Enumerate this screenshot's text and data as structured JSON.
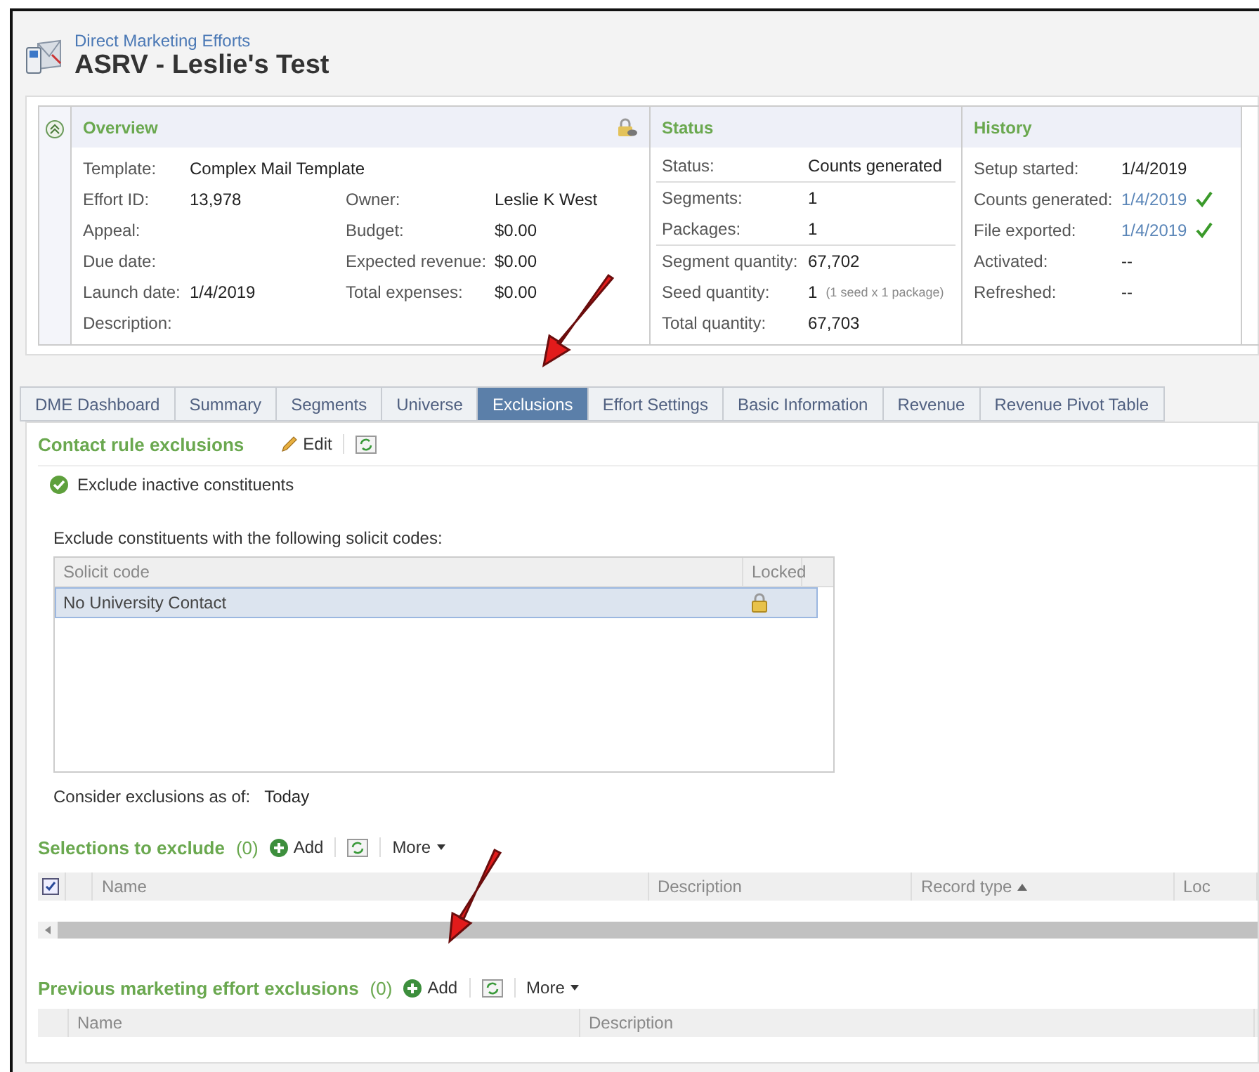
{
  "header": {
    "breadcrumb": "Direct Marketing Efforts",
    "title": "ASRV - Leslie's Test"
  },
  "overview": {
    "title": "Overview",
    "expanded": true,
    "left_fields": [
      {
        "label": "Template:",
        "value": "Complex Mail Template"
      },
      {
        "label": "Effort ID:",
        "value": "13,978"
      },
      {
        "label": "Appeal:"
      },
      {
        "label": "Due date:"
      },
      {
        "label": "Launch date:",
        "value": "1/4/2019"
      },
      {
        "label": "Description:"
      }
    ],
    "right_fields": [
      {
        "label": "Owner:",
        "value": "Leslie K West"
      },
      {
        "label": "Budget:",
        "value": "$0.00"
      },
      {
        "label": "Expected revenue:",
        "value": "$0.00"
      },
      {
        "label": "Total expenses:",
        "value": "$0.00"
      }
    ]
  },
  "status": {
    "title": "Status",
    "groups": [
      [
        {
          "label": "Status:",
          "value": "Counts generated"
        }
      ],
      [
        {
          "label": "Segments:",
          "value": "1"
        },
        {
          "label": "Packages:",
          "value": "1"
        }
      ],
      [
        {
          "label": "Segment quantity:",
          "value": "67,702"
        },
        {
          "label": "Seed quantity:",
          "value": "1",
          "note": "(1 seed x 1 package)"
        },
        {
          "label": "Total quantity:",
          "value": "67,703"
        }
      ]
    ]
  },
  "history": {
    "title": "History",
    "fields": [
      {
        "label": "Setup started:",
        "value": "1/4/2019",
        "done": false
      },
      {
        "label": "Counts generated:",
        "value": "1/4/2019",
        "done": true
      },
      {
        "label": "File exported:",
        "value": "1/4/2019",
        "done": true
      },
      {
        "label": "Activated:",
        "value": "--",
        "done": false
      },
      {
        "label": "Refreshed:",
        "value": "--",
        "done": false
      }
    ]
  },
  "tabs": [
    {
      "label": "DME Dashboard",
      "selected": false
    },
    {
      "label": "Summary",
      "selected": false
    },
    {
      "label": "Segments",
      "selected": false
    },
    {
      "label": "Universe",
      "selected": false
    },
    {
      "label": "Exclusions",
      "selected": true
    },
    {
      "label": "Effort Settings",
      "selected": false
    },
    {
      "label": "Basic Information",
      "selected": false
    },
    {
      "label": "Revenue",
      "selected": false
    },
    {
      "label": "Revenue Pivot Table",
      "selected": false
    }
  ],
  "contact_rules": {
    "title": "Contact rule exclusions",
    "edit": "Edit",
    "exclude_inactive": {
      "label": "Exclude inactive constituents",
      "checked": true
    },
    "intro": "Exclude constituents with the following solicit codes:",
    "columns": [
      "Solicit code",
      "Locked"
    ],
    "rows": [
      {
        "code": "No University Contact",
        "locked": true,
        "selected": true
      }
    ],
    "consider_label": "Consider exclusions as of:",
    "consider_value": "Today"
  },
  "selections": {
    "title": "Selections to exclude",
    "count": "(0)",
    "add": "Add",
    "more": "More",
    "all_checked": true,
    "columns": [
      "Name",
      "Description",
      "Record type",
      "Loc"
    ]
  },
  "previous": {
    "title": "Previous marketing effort exclusions",
    "count": "(0)",
    "add": "Add",
    "more": "More",
    "columns": [
      "Name",
      "Description"
    ]
  }
}
